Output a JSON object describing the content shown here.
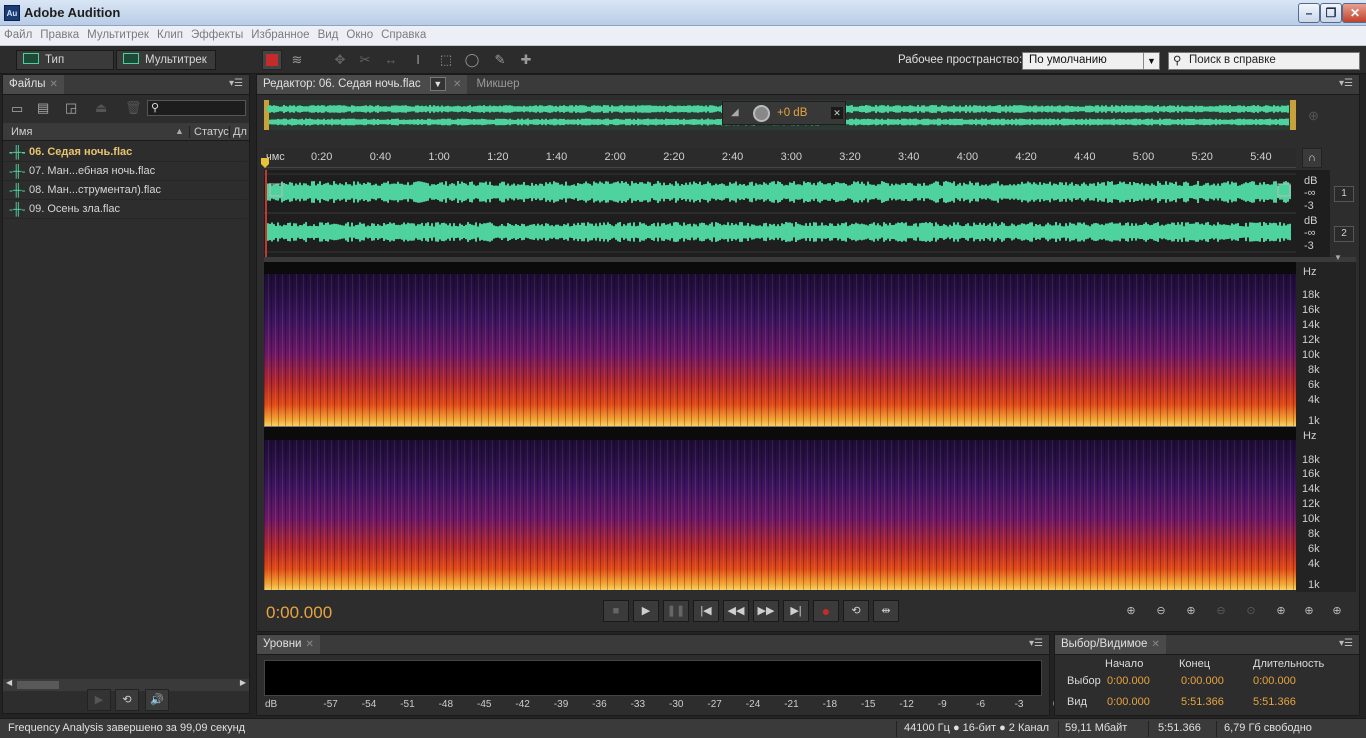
{
  "window": {
    "title": "Adobe Audition",
    "logo": "Au"
  },
  "menu": [
    "Файл",
    "Правка",
    "Мультитрек",
    "Клип",
    "Эффекты",
    "Избранное",
    "Вид",
    "Окно",
    "Справка"
  ],
  "toolbar": {
    "waveform_label": "Тип сигнала",
    "multitrack_label": "Мультитрек",
    "workspace_label": "Рабочее пространство:",
    "workspace_value": "По умолчанию",
    "help_search_placeholder": "Поиск в справке"
  },
  "files": {
    "tab": "Файлы",
    "col_name": "Имя",
    "col_status": "Статус",
    "col_dur": "Дл",
    "items": [
      "06. Седая ночь.flac",
      "07. Ман...ебная ночь.flac",
      "08. Ман...струментал).flac",
      "09. Осень зла.flac"
    ]
  },
  "editor": {
    "tab_editor": "Редактор: 06. Седая ночь.flac",
    "tab_mixer": "Микшер",
    "gain": "+0 dB",
    "timeline_unit": "чмс",
    "timeline": [
      "0:20",
      "0:40",
      "1:00",
      "1:20",
      "1:40",
      "2:00",
      "2:20",
      "2:40",
      "3:00",
      "3:20",
      "3:40",
      "4:00",
      "4:20",
      "4:40",
      "5:00",
      "5:20",
      "5:40"
    ],
    "channel_scale": [
      "dB",
      "-∞",
      "-3"
    ],
    "channels": [
      "1",
      "2"
    ],
    "hz_label": "Hz",
    "hz_scale": [
      "18k",
      "16k",
      "14k",
      "12k",
      "10k",
      "8k",
      "6k",
      "4k",
      "1k"
    ],
    "time_display": "0:00.000"
  },
  "levels": {
    "tab": "Уровни",
    "scale": [
      "dB",
      "-57",
      "-54",
      "-51",
      "-48",
      "-45",
      "-42",
      "-39",
      "-36",
      "-33",
      "-30",
      "-27",
      "-24",
      "-21",
      "-18",
      "-15",
      "-12",
      "-9",
      "-6",
      "-3",
      "0"
    ]
  },
  "selection": {
    "tab": "Выбор/Видимое",
    "col_start": "Начало",
    "col_end": "Конец",
    "col_dur": "Длительность",
    "row_sel": "Выбор",
    "row_view": "Вид",
    "sel_start": "0:00.000",
    "sel_end": "0:00.000",
    "sel_dur": "0:00.000",
    "view_start": "0:00.000",
    "view_end": "5:51.366",
    "view_dur": "5:51.366"
  },
  "status": {
    "message": "Frequency Analysis завершено за 99,09 секунд",
    "format": "44100 Гц ● 16-бит ● 2 Канал",
    "size": "59,11 Мбайт",
    "duration": "5:51.366",
    "free": "6,79 Гб свободно"
  },
  "colors": {
    "waveform": "#4fd39e",
    "accent": "#e8a440"
  }
}
